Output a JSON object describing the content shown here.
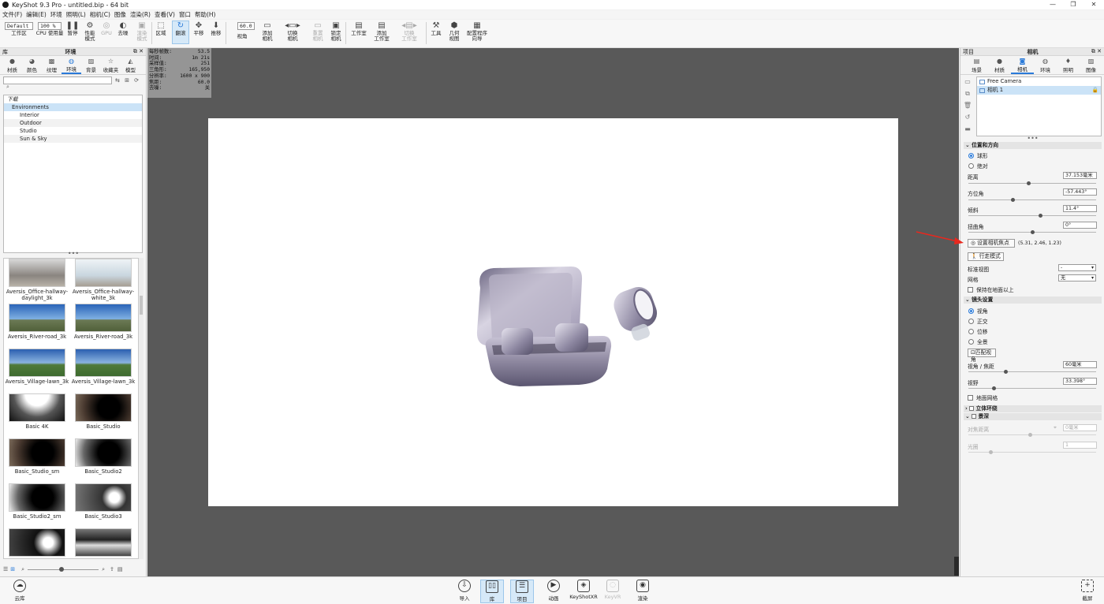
{
  "window": {
    "title": "KeyShot 9.3 Pro  - untitled.bip  - 64 bit",
    "controls": [
      "—",
      "❐",
      "✕"
    ]
  },
  "menu": [
    "文件(F)",
    "编辑(E)",
    "环境",
    "照明(L)",
    "相机(C)",
    "图像",
    "渲染(R)",
    "查看(V)",
    "窗口",
    "帮助(H)"
  ],
  "toolbar": {
    "workspace_select": "Default",
    "zoom_select": "100 %",
    "fov_value": "60.0",
    "items": {
      "workspace": "工作区",
      "cpu": "CPU 使用量",
      "pause": "暂停",
      "perf": "性能\n模式",
      "gpu": "GPU",
      "denoise": "去噪",
      "render_mode": "渲染\n模式",
      "region": "区域",
      "tumble": "翻滚",
      "pan": "平移",
      "dolly": "推移",
      "fov": "视角",
      "add_camera": "添加\n相机",
      "switch_camera": "切换\n相机",
      "reset_camera": "重置\n相机",
      "lock_camera": "锁定\n相机",
      "studio": "工作室",
      "add_studio": "添加\n工作室",
      "switch_studio": "切换\n工作室",
      "tools": "工具",
      "geometry_view": "几何\n视图",
      "config_wizard": "配置程序\n向导"
    }
  },
  "left_panel": {
    "header_left": "库",
    "header_center": "环境",
    "header_right": "⧉ ✕",
    "tabs": [
      "材质",
      "颜色",
      "纹理",
      "环境",
      "背景",
      "收藏夹",
      "模型"
    ],
    "active_tab": "环境",
    "search_placeholder": "",
    "tree": [
      "下载",
      "Environments",
      "Interior",
      "Outdoor",
      "Studio",
      "Sun & Sky"
    ],
    "thumbnails": [
      "Aversis_Office-hallway-\ndaylight_3k",
      "Aversis_Office-hallway-\nwhite_3k",
      "Aversis_River-road_3k",
      "Aversis_River-road_3k",
      "Aversis_Village-lawn_3k",
      "Aversis_Village-lawn_3k",
      "Basic 4K",
      "Basic_Studio",
      "Basic_Studio_sm",
      "Basic_Studio2",
      "Basic_Studio2_sm",
      "Basic_Studio3",
      "",
      ""
    ]
  },
  "stats": [
    [
      "每秒帧数:",
      "53.5"
    ],
    [
      "时间:",
      "1m 21s"
    ],
    [
      "采样值:",
      "251"
    ],
    [
      "三角形:",
      "165,950"
    ],
    [
      "分辨率:",
      "1600 x 900"
    ],
    [
      "焦距:",
      "60.0"
    ],
    [
      "去噪:",
      "关"
    ]
  ],
  "right_panel": {
    "header_left": "项目",
    "header_center": "相机",
    "header_right": "⧉ ✕",
    "tabs": [
      "场景",
      "材质",
      "相机",
      "环境",
      "照明",
      "图像"
    ],
    "active_tab": "相机",
    "cameras": [
      "Free Camera",
      "相机 1"
    ],
    "position_section": "位置和方向",
    "mode_options": [
      "球形",
      "绝对"
    ],
    "distance_label": "距离",
    "distance_value": "37.153毫米",
    "azimuth_label": "方位角",
    "azimuth_value": "-57.443°",
    "incline_label": "倾斜",
    "incline_value": "11.4°",
    "twist_label": "扭曲角",
    "twist_value": "0°",
    "set_focus_button": "设置相机焦点",
    "focus_coords": "(5.31, 2.46, 1.23)",
    "walk_mode_button": "行走模式",
    "std_view_label": "标准视图",
    "std_view_value": "-",
    "grid_label": "网格",
    "grid_value": "无",
    "keep_above_ground": "保持在地面以上",
    "lens_section": "镜头设置",
    "lens_options": [
      "视角",
      "正交",
      "位移",
      "全景"
    ],
    "match_fov_button": "匹配视角",
    "fov_focal_label": "视角 / 焦距",
    "fov_focal_value": "60毫米",
    "field_of_view_label": "视野",
    "field_of_view_value": "33.398°",
    "ground_grid": "地面网格",
    "stereo_section": "立体环绕",
    "dof_section": "景深",
    "focus_distance_label": "对焦距离",
    "focus_distance_value": "0毫米",
    "aperture_label": "光圈",
    "aperture_value": "1"
  },
  "bottom_bar": {
    "cloud_library": "云库",
    "import": "导入",
    "library": "库",
    "project": "项目",
    "animation": "动画",
    "keyshotxr": "KeyShotXR",
    "keyvr": "KeyVR",
    "render": "渲染",
    "screenshot": "截屏"
  },
  "colors": {
    "accent": "#2a7ad9",
    "viewport": "#595959",
    "canvas": "#ffffff",
    "arrow": "#e8281e"
  }
}
